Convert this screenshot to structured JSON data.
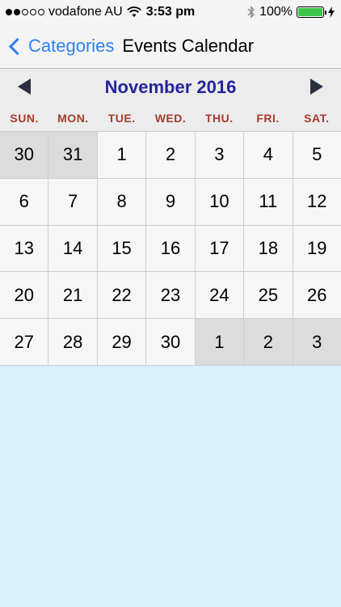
{
  "status_bar": {
    "carrier": "vodafone AU",
    "time": "3:53 pm",
    "battery": "100%",
    "battery_level": 1.0
  },
  "nav": {
    "back_label": "Categories",
    "title": "Events Calendar"
  },
  "calendar": {
    "month_title": "November 2016",
    "weekdays": [
      "SUN.",
      "MON.",
      "TUE.",
      "WED.",
      "THU.",
      "FRI.",
      "SAT."
    ],
    "days": [
      {
        "label": "30",
        "other_month": true
      },
      {
        "label": "31",
        "other_month": true
      },
      {
        "label": "1",
        "other_month": false
      },
      {
        "label": "2",
        "other_month": false
      },
      {
        "label": "3",
        "other_month": false
      },
      {
        "label": "4",
        "other_month": false
      },
      {
        "label": "5",
        "other_month": false
      },
      {
        "label": "6",
        "other_month": false
      },
      {
        "label": "7",
        "other_month": false
      },
      {
        "label": "8",
        "other_month": false
      },
      {
        "label": "9",
        "other_month": false
      },
      {
        "label": "10",
        "other_month": false
      },
      {
        "label": "11",
        "other_month": false
      },
      {
        "label": "12",
        "other_month": false
      },
      {
        "label": "13",
        "other_month": false
      },
      {
        "label": "14",
        "other_month": false
      },
      {
        "label": "15",
        "other_month": false
      },
      {
        "label": "16",
        "other_month": false
      },
      {
        "label": "17",
        "other_month": false
      },
      {
        "label": "18",
        "other_month": false
      },
      {
        "label": "19",
        "other_month": false
      },
      {
        "label": "20",
        "other_month": false
      },
      {
        "label": "21",
        "other_month": false
      },
      {
        "label": "22",
        "other_month": false
      },
      {
        "label": "23",
        "other_month": false
      },
      {
        "label": "24",
        "other_month": false
      },
      {
        "label": "25",
        "other_month": false
      },
      {
        "label": "26",
        "other_month": false
      },
      {
        "label": "27",
        "other_month": false
      },
      {
        "label": "28",
        "other_month": false
      },
      {
        "label": "29",
        "other_month": false
      },
      {
        "label": "30",
        "other_month": false
      },
      {
        "label": "1",
        "other_month": true
      },
      {
        "label": "2",
        "other_month": true
      },
      {
        "label": "3",
        "other_month": true
      }
    ]
  }
}
